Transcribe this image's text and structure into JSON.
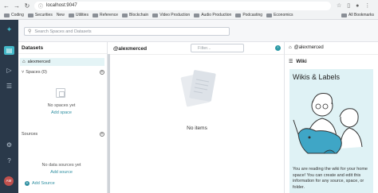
{
  "browser": {
    "url": "localhost:9047",
    "bookmarks": [
      "Coding",
      "Securities",
      "New",
      "Utilities",
      "Reference",
      "Blockchain",
      "Video Production",
      "Audio Production",
      "Podcasting",
      "Economics"
    ],
    "all_bookmarks": "All Bookmarks"
  },
  "header": {
    "search_placeholder": "Search Spaces and Datasets"
  },
  "datasets_panel": {
    "title": "Datasets",
    "home": "alexmerced",
    "spaces_label": "Spaces (0)",
    "no_spaces": "No spaces yet",
    "add_space": "Add space",
    "sources_label": "Sources",
    "no_sources": "No data sources yet",
    "add_source_link": "Add source",
    "add_source_button": "Add Source"
  },
  "main": {
    "title": "@alexmerced",
    "filter_placeholder": "Filter...",
    "empty": "No items"
  },
  "wiki": {
    "owner": "@alexmerced",
    "section": "Wiki",
    "card_title": "Wikis & Labels",
    "description": "You are reading the wiki for your home space! You can create and edit this information for any source, space, or folder."
  },
  "user": {
    "initials": "AM"
  },
  "colors": {
    "rail": "#2a394a",
    "accent": "#43b8c9",
    "link": "#2d8ea0",
    "wiki_card": "#dff2f5"
  }
}
